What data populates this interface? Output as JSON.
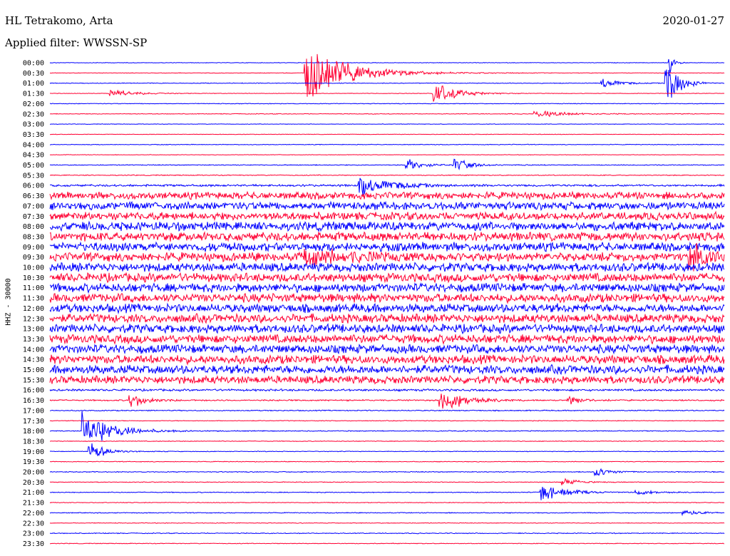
{
  "header": {
    "station": "HL Tetrakomo, Arta",
    "date": "2020-01-27",
    "filter": "Applied filter: WWSSN-SP"
  },
  "chart_data": {
    "type": "line",
    "ylabel": "HHZ - 30000",
    "time_labels": [
      "00:00",
      "00:30",
      "01:00",
      "01:30",
      "02:00",
      "02:30",
      "03:00",
      "03:30",
      "04:00",
      "04:30",
      "05:00",
      "05:30",
      "06:00",
      "06:30",
      "07:00",
      "07:30",
      "08:00",
      "08:30",
      "09:00",
      "09:30",
      "10:00",
      "10:30",
      "11:00",
      "11:30",
      "12:00",
      "12:30",
      "13:00",
      "13:30",
      "14:00",
      "14:30",
      "15:00",
      "15:30",
      "16:00",
      "16:30",
      "17:00",
      "17:30",
      "18:00",
      "18:30",
      "19:00",
      "19:30",
      "20:00",
      "20:30",
      "21:00",
      "21:30",
      "22:00",
      "22:30",
      "23:00",
      "23:30"
    ],
    "trace_colors": [
      "#0000ff",
      "#ff0033"
    ],
    "noise_level": [
      0.3,
      0.3,
      0.4,
      0.3,
      0.4,
      0.4,
      0.3,
      0.3,
      0.4,
      0.3,
      0.5,
      0.5,
      1.2,
      4.0,
      4.5,
      4.5,
      5.0,
      5.0,
      5.0,
      5.0,
      5.0,
      5.0,
      5.0,
      5.0,
      5.0,
      5.0,
      5.0,
      5.0,
      5.0,
      5.0,
      5.0,
      4.5,
      1.2,
      0.8,
      0.6,
      0.4,
      0.5,
      0.4,
      0.4,
      0.4,
      0.5,
      0.4,
      0.5,
      0.4,
      0.5,
      0.4,
      0.5,
      0.4
    ],
    "events": [
      {
        "row": 1,
        "t": 0.38,
        "amp": 45,
        "dur": 0.06
      },
      {
        "row": 3,
        "t": 0.57,
        "amp": 18,
        "dur": 0.03
      },
      {
        "row": 3,
        "t": 0.09,
        "amp": 8,
        "dur": 0.03
      },
      {
        "row": 2,
        "t": 0.82,
        "amp": 10,
        "dur": 0.02
      },
      {
        "row": 2,
        "t": 0.915,
        "amp": 55,
        "dur": 0.015
      },
      {
        "row": 0,
        "t": 0.92,
        "amp": 25,
        "dur": 0.005
      },
      {
        "row": 5,
        "t": 0.72,
        "amp": 6,
        "dur": 0.04
      },
      {
        "row": 10,
        "t": 0.53,
        "amp": 10,
        "dur": 0.02
      },
      {
        "row": 10,
        "t": 0.6,
        "amp": 12,
        "dur": 0.02
      },
      {
        "row": 12,
        "t": 0.46,
        "amp": 18,
        "dur": 0.04
      },
      {
        "row": 19,
        "t": 0.38,
        "amp": 14,
        "dur": 0.05
      },
      {
        "row": 19,
        "t": 0.95,
        "amp": 22,
        "dur": 0.02
      },
      {
        "row": 33,
        "t": 0.58,
        "amp": 22,
        "dur": 0.03
      },
      {
        "row": 33,
        "t": 0.12,
        "amp": 14,
        "dur": 0.02
      },
      {
        "row": 33,
        "t": 0.77,
        "amp": 6,
        "dur": 0.02
      },
      {
        "row": 36,
        "t": 0.05,
        "amp": 30,
        "dur": 0.04
      },
      {
        "row": 38,
        "t": 0.06,
        "amp": 16,
        "dur": 0.02
      },
      {
        "row": 41,
        "t": 0.76,
        "amp": 8,
        "dur": 0.02
      },
      {
        "row": 42,
        "t": 0.73,
        "amp": 16,
        "dur": 0.03
      },
      {
        "row": 42,
        "t": 0.87,
        "amp": 5,
        "dur": 0.02
      },
      {
        "row": 44,
        "t": 0.94,
        "amp": 6,
        "dur": 0.02
      },
      {
        "row": 40,
        "t": 0.81,
        "amp": 8,
        "dur": 0.02
      }
    ]
  }
}
